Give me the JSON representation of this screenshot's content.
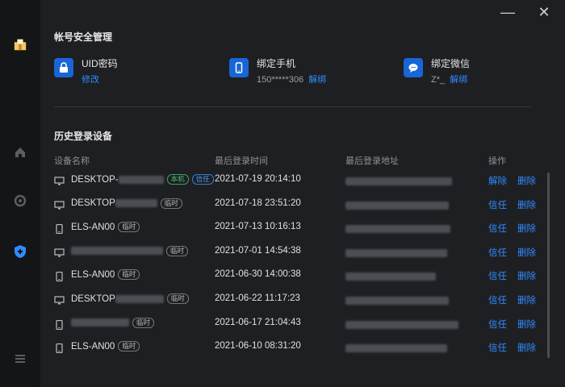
{
  "window": {
    "minimize": "—",
    "close": "✕"
  },
  "sidebar": {
    "items": [
      {
        "name": "app-logo-icon"
      },
      {
        "name": "home-icon"
      },
      {
        "name": "circle-icon"
      },
      {
        "name": "shield-plus-icon"
      },
      {
        "name": "menu-icon"
      }
    ]
  },
  "account": {
    "title": "帐号安全管理",
    "uid": {
      "label": "UID密码",
      "action": "修改"
    },
    "phone": {
      "label": "绑定手机",
      "value": "150*****306",
      "action": "解绑"
    },
    "wechat": {
      "label": "绑定微信",
      "value": "Z*_",
      "action": "解绑"
    }
  },
  "history": {
    "title": "历史登录设备",
    "columns": [
      "设备名称",
      "最后登录时间",
      "最后登录地址",
      "操作"
    ],
    "rows": [
      {
        "device": "DESKTOP-",
        "blur_w": 56,
        "tags": [
          "本机",
          "信任"
        ],
        "time": "2021-07-19 20:14:10",
        "icon": "monitor",
        "addr_w": 132,
        "actions": [
          "解除",
          "删除"
        ]
      },
      {
        "device": "DESKTOP",
        "blur_w": 52,
        "tags": [
          "临时"
        ],
        "time": "2021-07-18 23:51:20",
        "icon": "monitor",
        "addr_w": 128,
        "actions": [
          "信任",
          "删除"
        ]
      },
      {
        "device": "ELS-AN00",
        "blur_w": 0,
        "tags": [
          "临时"
        ],
        "time": "2021-07-13 10:16:13",
        "icon": "phone",
        "addr_w": 130,
        "actions": [
          "信任",
          "删除"
        ]
      },
      {
        "device": "",
        "blur_w": 114,
        "tags": [
          "临时"
        ],
        "time": "2021-07-01 14:54:38",
        "icon": "monitor",
        "addr_w": 126,
        "actions": [
          "信任",
          "删除"
        ]
      },
      {
        "device": "ELS-AN00",
        "blur_w": 0,
        "tags": [
          "临时"
        ],
        "time": "2021-06-30 14:00:38",
        "icon": "phone",
        "addr_w": 112,
        "actions": [
          "信任",
          "删除"
        ]
      },
      {
        "device": "DESKTOP",
        "blur_w": 60,
        "tags": [
          "临时"
        ],
        "time": "2021-06-22 11:17:23",
        "icon": "monitor",
        "addr_w": 128,
        "actions": [
          "信任",
          "删除"
        ]
      },
      {
        "device": "",
        "blur_w": 72,
        "tags": [
          "临时"
        ],
        "time": "2021-06-17 21:04:43",
        "icon": "phone",
        "addr_w": 140,
        "actions": [
          "信任",
          "删除"
        ]
      },
      {
        "device": "ELS-AN00",
        "blur_w": 0,
        "tags": [
          "临时"
        ],
        "time": "2021-06-10 08:31:20",
        "icon": "phone",
        "addr_w": 126,
        "actions": [
          "信任",
          "删除"
        ]
      }
    ]
  },
  "colors": {
    "accent": "#2f8cff",
    "bg": "#1e1f22",
    "sidebar": "#141517"
  }
}
